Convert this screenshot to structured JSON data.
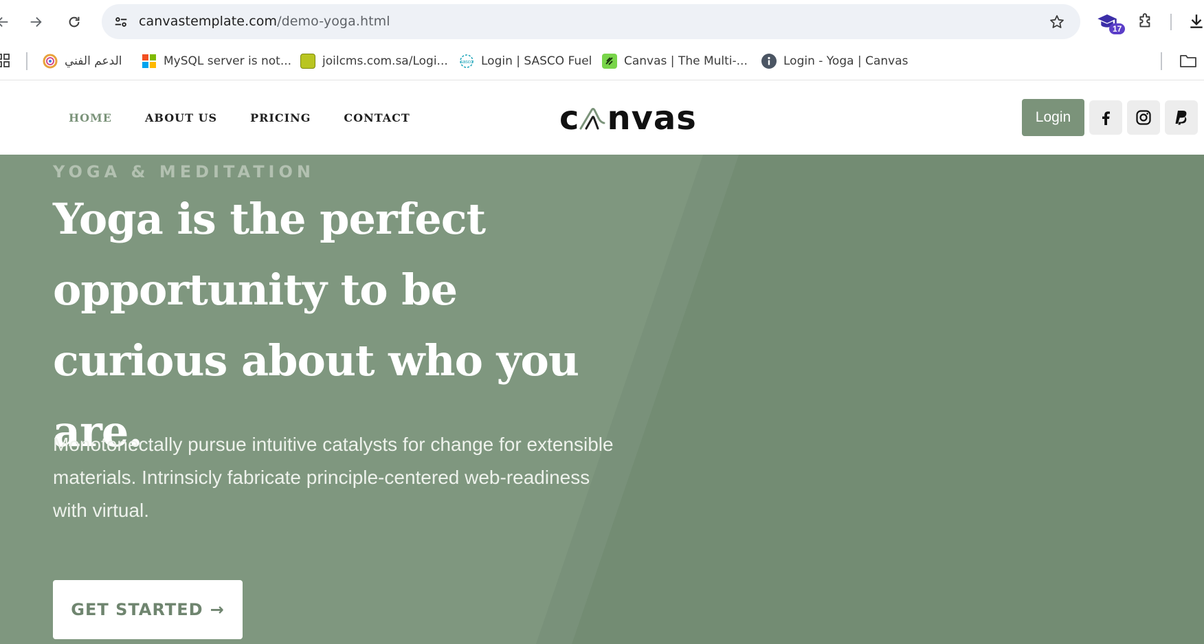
{
  "browser": {
    "url_domain": "canvastemplate.com",
    "url_path": "/demo-yoga.html",
    "extension_badge": "17"
  },
  "bookmarks": [
    {
      "label": "الدعم الفني",
      "icon": "support-icon"
    },
    {
      "label": "MySQL server is not...",
      "icon": "microsoft-icon"
    },
    {
      "label": "joilcms.com.sa/Logi...",
      "icon": "joil-icon"
    },
    {
      "label": "Login | SASCO Fuel",
      "icon": "sasco-icon"
    },
    {
      "label": "Canvas | The Multi-...",
      "icon": "canvas-icon"
    },
    {
      "label": "Login - Yoga | Canvas",
      "icon": "info-icon"
    }
  ],
  "site": {
    "menu": [
      "HOME",
      "ABOUT US",
      "PRICING",
      "CONTACT"
    ],
    "logo_left": "c",
    "logo_right": "nvas",
    "login_label": "Login",
    "social_icons": [
      "facebook-icon",
      "instagram-icon",
      "paypal-icon"
    ],
    "accent_color": "#7b937a"
  },
  "hero": {
    "eyebrow": "YOGA & MEDITATION",
    "headline": "Yoga is the perfect opportunity to be curious about who you are.",
    "subtext": "Monotonectally pursue intuitive catalysts for change for extensible materials. Intrinsicly fabricate principle-centered web-readiness with virtual.",
    "cta_label": "GET STARTED",
    "cta_arrow": "→",
    "background_color": "#7f977f"
  }
}
